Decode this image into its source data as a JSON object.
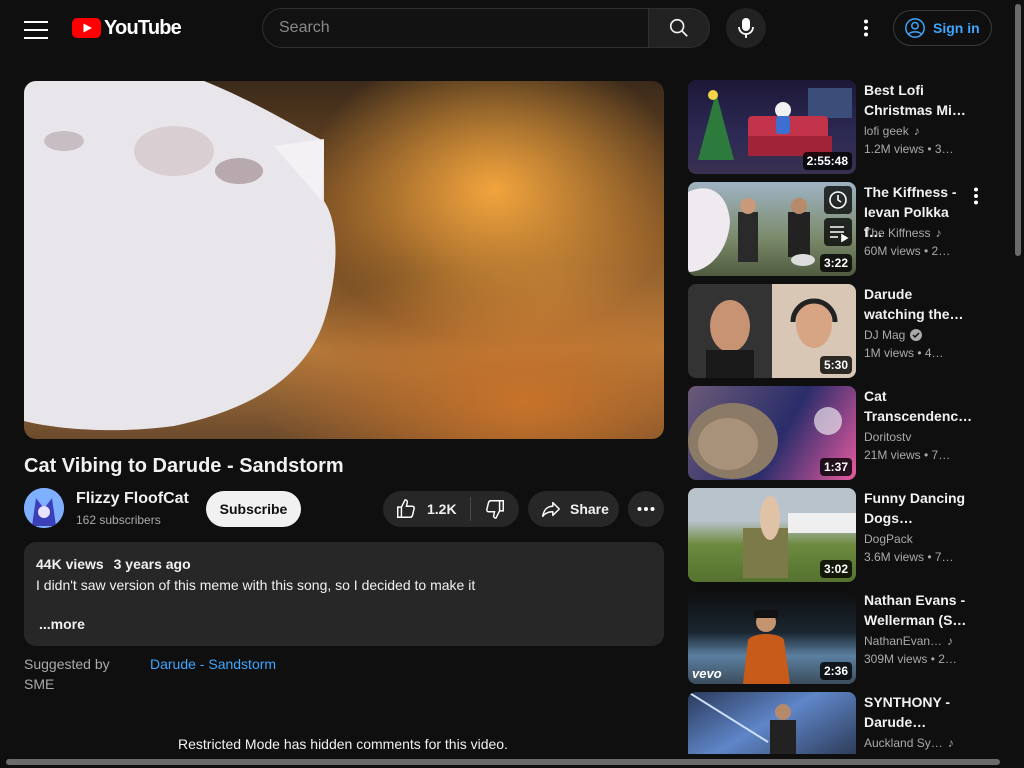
{
  "header": {
    "logo_text": "YouTube",
    "search_placeholder": "Search",
    "sign_in_label": "Sign in",
    "icons": [
      "menu-icon",
      "youtube-logo-icon",
      "search-icon",
      "microphone-icon",
      "more-vert-icon",
      "account-icon"
    ]
  },
  "video": {
    "title": "Cat Vibing to Darude - Sandstorm",
    "channel_name": "Flizzy FloofCat",
    "subscribers": "162 subscribers",
    "subscribe_label": "Subscribe",
    "likes": "1.2K",
    "share_label": "Share",
    "views": "44K views",
    "age": "3 years ago",
    "description": "I didn't saw version of this meme with this song, so I decided to make it",
    "more_label": "...more",
    "suggested_by_label": "Suggested by SME",
    "suggested_link": "Darude - Sandstorm",
    "restricted_note": "Restricted Mode has hidden comments for this video."
  },
  "recommendations": [
    {
      "title_l1": "Best Lofi",
      "title_l2": "Christmas Mi…",
      "channel": "lofi geek",
      "badge": "music-note-icon",
      "meta": "1.2M views  • 3…",
      "duration": "2:55:48"
    },
    {
      "title_l1": "The Kiffness -",
      "title_l2": "Ievan Polkka f…",
      "channel": "The Kiffness",
      "badge": "music-note-icon",
      "meta": "60M views  • 2…",
      "duration": "3:22"
    },
    {
      "title_l1": "Darude",
      "title_l2": "watching the…",
      "channel": "DJ Mag",
      "badge": "verified-icon",
      "meta": "1M views  • 4…",
      "duration": "5:30"
    },
    {
      "title_l1": "Cat",
      "title_l2": "Transcendenc…",
      "channel": "Doritostv",
      "badge": "",
      "meta": "21M views  • 7…",
      "duration": "1:37"
    },
    {
      "title_l1": "Funny Dancing",
      "title_l2": "Dogs…",
      "channel": "DogPack",
      "badge": "",
      "meta": "3.6M views  • 7…",
      "duration": "3:02"
    },
    {
      "title_l1": "Nathan Evans -",
      "title_l2": "Wellerman (S…",
      "channel": "NathanEvan…",
      "badge": "music-note-icon",
      "meta": "309M views  • 2…",
      "duration": "2:36",
      "overlay": "vevo"
    },
    {
      "title_l1": "SYNTHONY -",
      "title_l2": "Darude…",
      "channel": "Auckland Sy…",
      "badge": "music-note-icon",
      "meta": "",
      "duration": ""
    }
  ],
  "colors": {
    "background": "#0f0f0f",
    "surface": "#272727",
    "accent_link": "#3ea6ff",
    "logo_red": "#ff0000"
  }
}
